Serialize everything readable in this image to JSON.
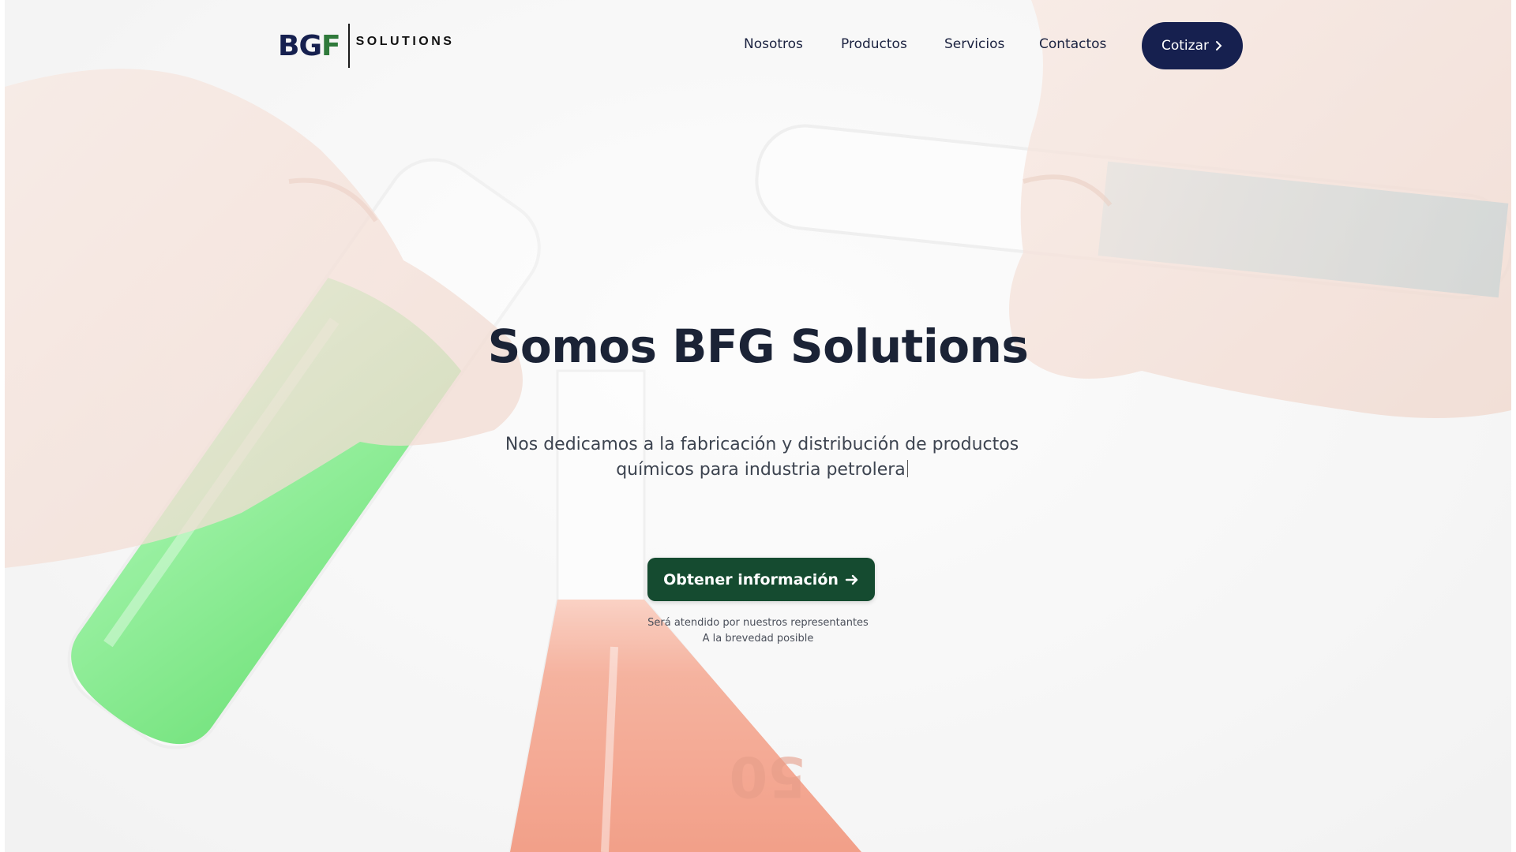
{
  "brand": {
    "mark_b": "BG",
    "mark_f": "F",
    "tagline": "SOLUTIONS"
  },
  "nav": {
    "items": [
      "Nosotros",
      "Productos",
      "Servicios",
      "Contactos"
    ],
    "cta_label": "Cotizar"
  },
  "hero": {
    "title": "Somos BFG Solutions",
    "subtitle_line1": "Nos dedicamos a la fabricación y distribución de productos",
    "subtitle_line2": "químicos para industria petrolera",
    "cta_label": "Obtener información",
    "note_line1": "Será atendido por nuestros representantes",
    "note_line2": "A la brevedad posible"
  },
  "colors": {
    "navy": "#16204f",
    "green": "#154b30",
    "liquid_green": "#3ee04a",
    "liquid_blue": "#2bb7dd",
    "liquid_orange": "#f07a58"
  },
  "icons": {
    "cta_top": "chevron-right-icon",
    "cta_main": "arrow-right-icon"
  }
}
